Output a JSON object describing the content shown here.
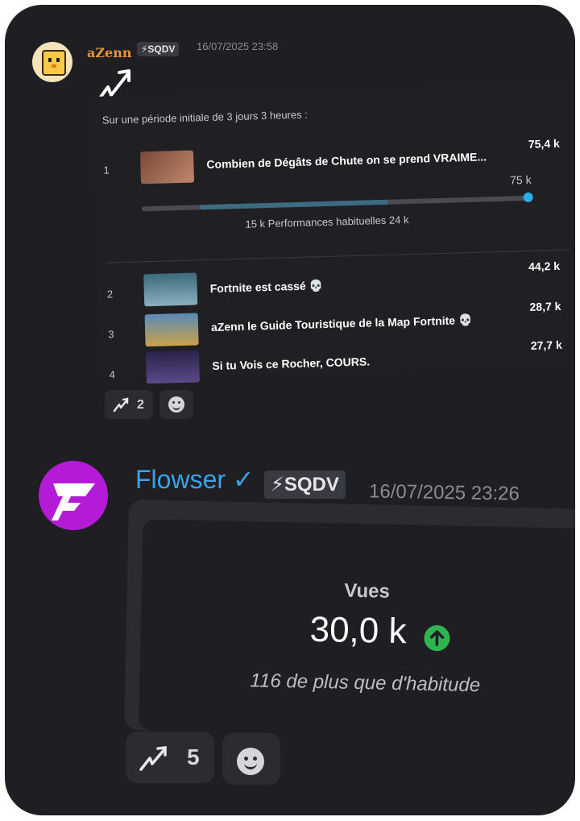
{
  "message1": {
    "username": "aZenn",
    "tag": "⚡SQDV",
    "timestamp": "16/07/2025 23:58",
    "period_text": "Sur une période initiale de 3 jours 3 heures :",
    "videos": [
      {
        "rank": "1",
        "title": "Combien de Dégâts de Chute on se prend VRAIME...",
        "views": "75,4 k"
      },
      {
        "rank": "2",
        "title": "Fortnite est cassé 💀",
        "views": "44,2 k"
      },
      {
        "rank": "3",
        "title": "aZenn le Guide Touristique de la Map Fortnite 💀",
        "views": "28,7 k"
      },
      {
        "rank": "4",
        "title": "Si tu Vois ce Rocher, COURS.",
        "views": "27,7 k"
      }
    ],
    "bar": {
      "current_label": "75 k",
      "range_label": "15 k Performances habituelles 24 k",
      "level": 1.0
    },
    "reactions": {
      "count": "2"
    }
  },
  "message2": {
    "username": "Flowser ✓",
    "tag": "⚡SQDV",
    "timestamp": "16/07/2025 23:26",
    "stat_label": "Vues",
    "stat_value": "30,0 k",
    "stat_diff": "116 de plus que d'habitude",
    "reactions": {
      "count": "5"
    }
  },
  "colors": {
    "background": "#1e1e23",
    "username1": "#e8953a",
    "username2": "#3aa3e6",
    "accent_bar": "#2ab0e8",
    "up_badge": "#2fb550"
  },
  "icons": [
    "trend-arrow-icon",
    "smile-icon",
    "arrow-up-icon",
    "lightning-icon"
  ]
}
